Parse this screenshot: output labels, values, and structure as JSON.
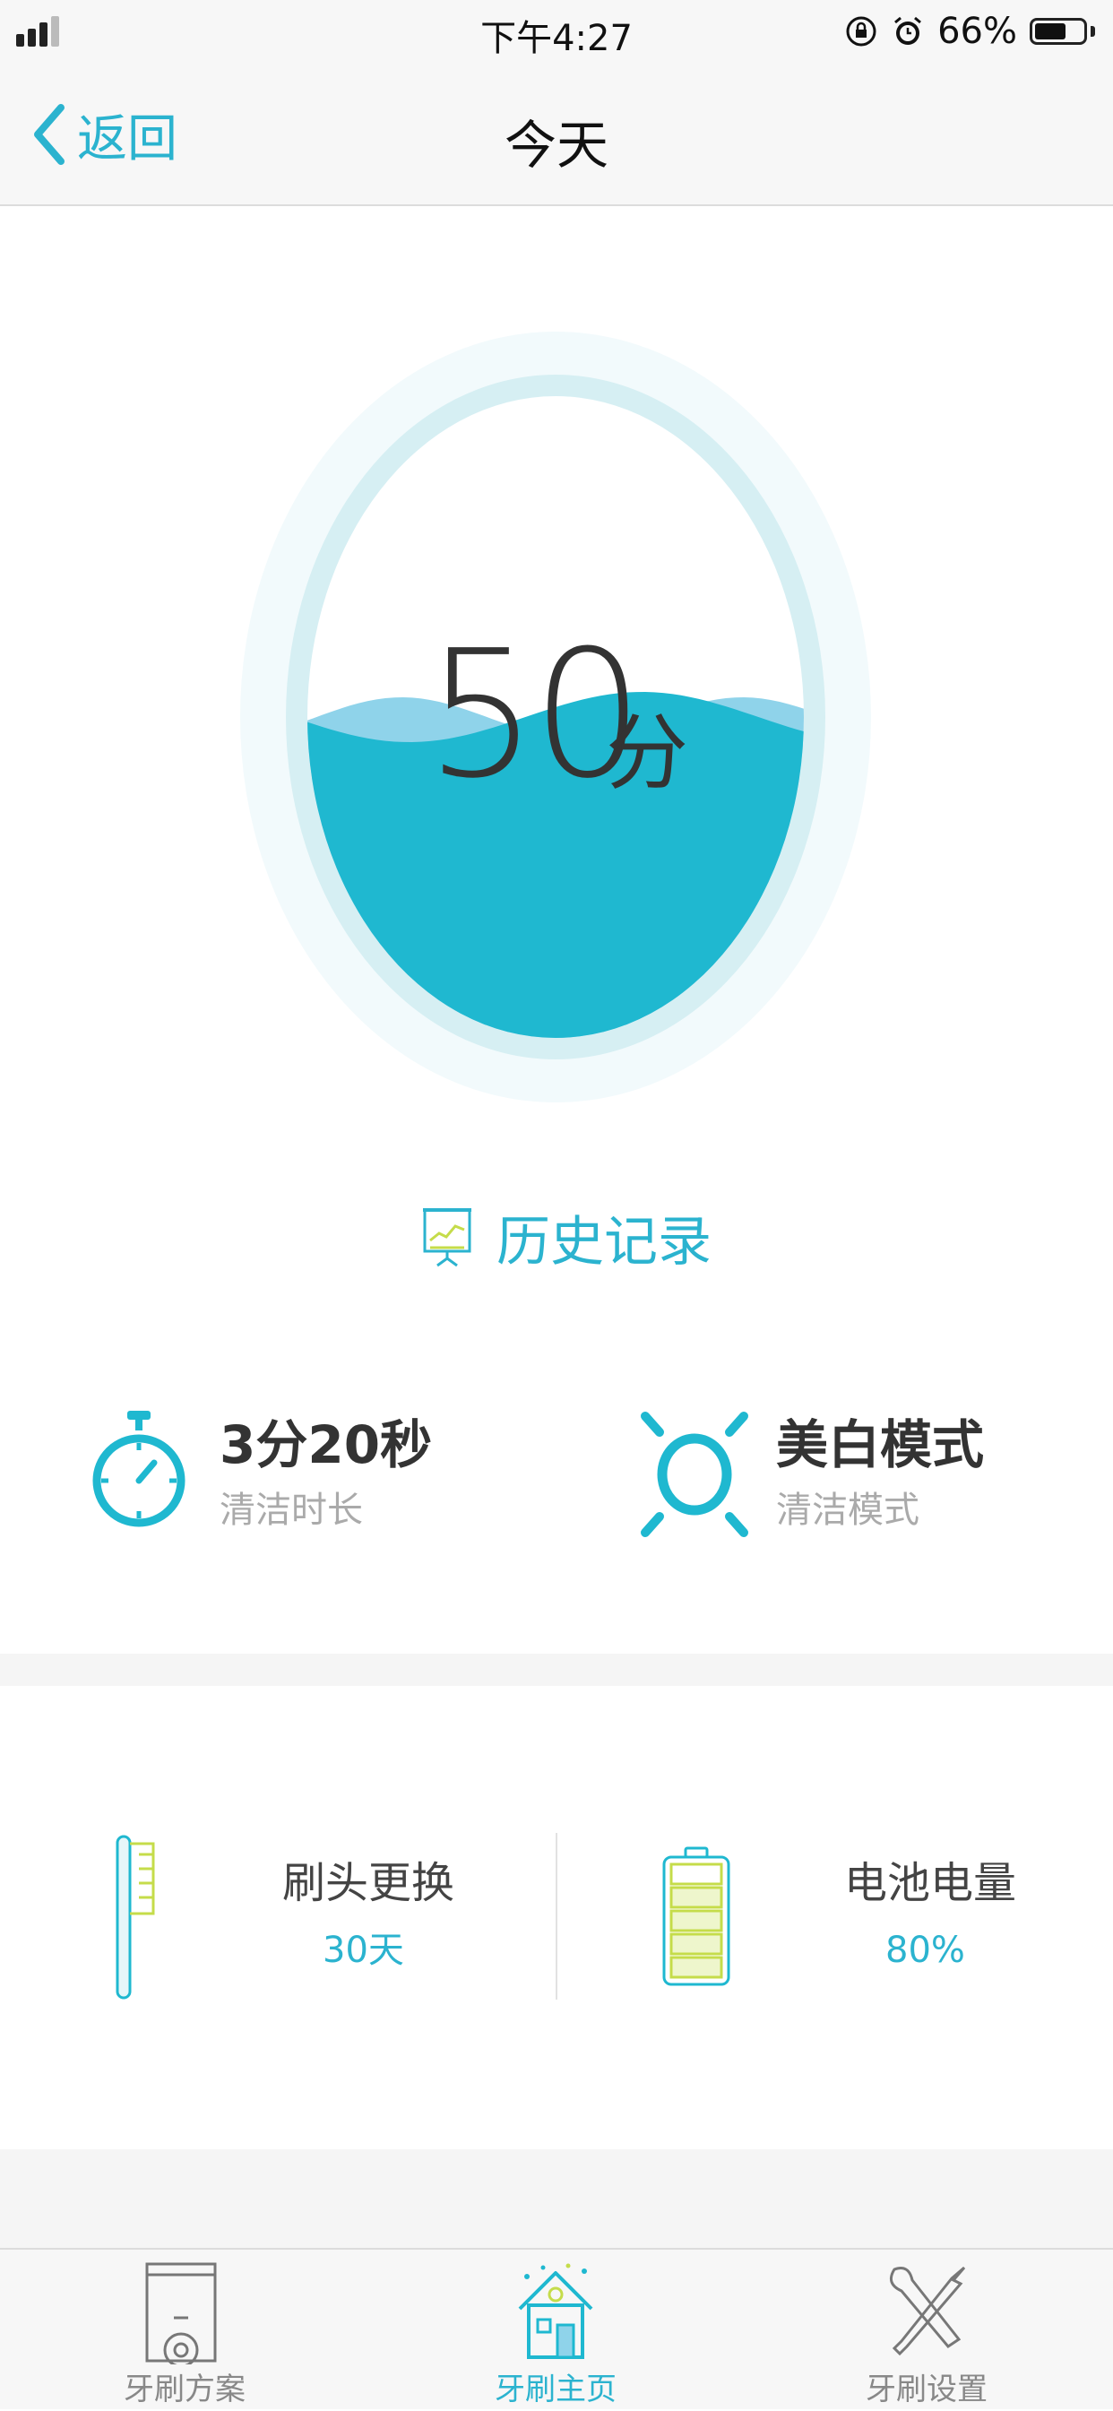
{
  "status_bar": {
    "time": "下午4:27",
    "battery_percent": "66%",
    "battery_level": 0.66,
    "icons": [
      "signal-icon",
      "rotation-lock-icon",
      "alarm-icon",
      "battery-icon"
    ]
  },
  "nav": {
    "back_label": "返回",
    "title": "今天"
  },
  "score": {
    "value": "50",
    "unit": "分",
    "level": 0.5
  },
  "history": {
    "label": "历史记录"
  },
  "stats": {
    "duration": {
      "value": "3分20秒",
      "label": "清洁时长",
      "icon": "stopwatch-icon"
    },
    "mode": {
      "value": "美白模式",
      "label": "清洁模式",
      "icon": "sun-icon"
    }
  },
  "devices": {
    "brush_head": {
      "title": "刷头更换",
      "value": "30天",
      "icon": "toothbrush-icon"
    },
    "battery": {
      "title": "电池电量",
      "value": "80%",
      "icon": "battery-level-icon",
      "level": 0.8
    }
  },
  "tabs": [
    {
      "label": "牙刷方案",
      "icon": "plan-gear-icon",
      "active": false
    },
    {
      "label": "牙刷主页",
      "icon": "home-icon",
      "active": true
    },
    {
      "label": "牙刷设置",
      "icon": "tools-icon",
      "active": false
    }
  ],
  "colors": {
    "accent": "#2bb3cf",
    "water": "#1fb8d0",
    "wave_light": "#8fd3ea",
    "ring_outer": "#f2fafc",
    "ring_inner": "#d6eff3",
    "battery_green": "#c5dc4a"
  }
}
